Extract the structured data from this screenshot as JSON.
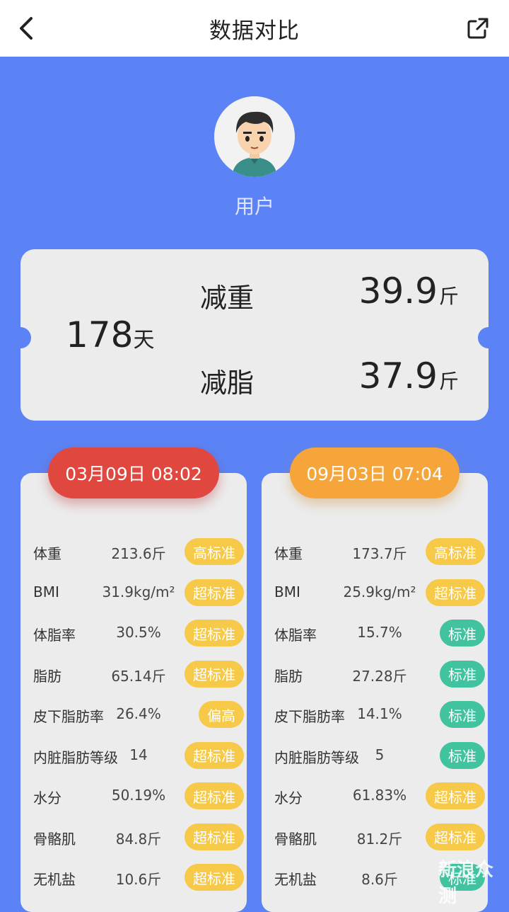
{
  "header": {
    "title": "数据对比",
    "back_icon": "chevron-left-icon",
    "share_icon": "share-icon"
  },
  "user": {
    "name": "用户"
  },
  "summary": {
    "days": "178",
    "days_unit": "天",
    "weight_loss_label": "减重",
    "weight_loss_value": "39.9",
    "weight_loss_unit": "斤",
    "fat_loss_label": "减脂",
    "fat_loss_value": "37.9",
    "fat_loss_unit": "斤"
  },
  "left": {
    "date": "03月09日 08:02",
    "rows": [
      {
        "name": "体重",
        "value": "213.6斤",
        "tag": "高标准",
        "color": "yellow"
      },
      {
        "name": "BMI",
        "value": "31.9kg/m²",
        "tag": "超标准",
        "color": "yellow"
      },
      {
        "name": "体脂率",
        "value": "30.5%",
        "tag": "超标准",
        "color": "yellow"
      },
      {
        "name": "脂肪",
        "value": "65.14斤",
        "tag": "超标准",
        "color": "yellow"
      },
      {
        "name": "皮下脂肪率",
        "value": "26.4%",
        "tag": "偏高",
        "color": "yellow"
      },
      {
        "name": "内脏脂肪等级",
        "value": "14",
        "tag": "超标准",
        "color": "yellow"
      },
      {
        "name": "水分",
        "value": "50.19%",
        "tag": "超标准",
        "color": "yellow"
      },
      {
        "name": "骨骼肌",
        "value": "84.8斤",
        "tag": "超标准",
        "color": "yellow"
      },
      {
        "name": "无机盐",
        "value": "10.6斤",
        "tag": "超标准",
        "color": "yellow"
      }
    ]
  },
  "right": {
    "date": "09月03日 07:04",
    "rows": [
      {
        "name": "体重",
        "value": "173.7斤",
        "tag": "高标准",
        "color": "yellow"
      },
      {
        "name": "BMI",
        "value": "25.9kg/m²",
        "tag": "超标准",
        "color": "yellow"
      },
      {
        "name": "体脂率",
        "value": "15.7%",
        "tag": "标准",
        "color": "green"
      },
      {
        "name": "脂肪",
        "value": "27.28斤",
        "tag": "标准",
        "color": "green"
      },
      {
        "name": "皮下脂肪率",
        "value": "14.1%",
        "tag": "标准",
        "color": "green"
      },
      {
        "name": "内脏脂肪等级",
        "value": "5",
        "tag": "标准",
        "color": "green"
      },
      {
        "name": "水分",
        "value": "61.83%",
        "tag": "超标准",
        "color": "yellow"
      },
      {
        "name": "骨骼肌",
        "value": "81.2斤",
        "tag": "超标准",
        "color": "yellow"
      },
      {
        "name": "无机盐",
        "value": "8.6斤",
        "tag": "标准",
        "color": "green"
      }
    ]
  },
  "watermark": "新浪众测",
  "colors": {
    "background": "#5b83f5",
    "red": "#e0473f",
    "orange": "#f6a53a",
    "yellow": "#f7c948",
    "green": "#41c3a0"
  }
}
